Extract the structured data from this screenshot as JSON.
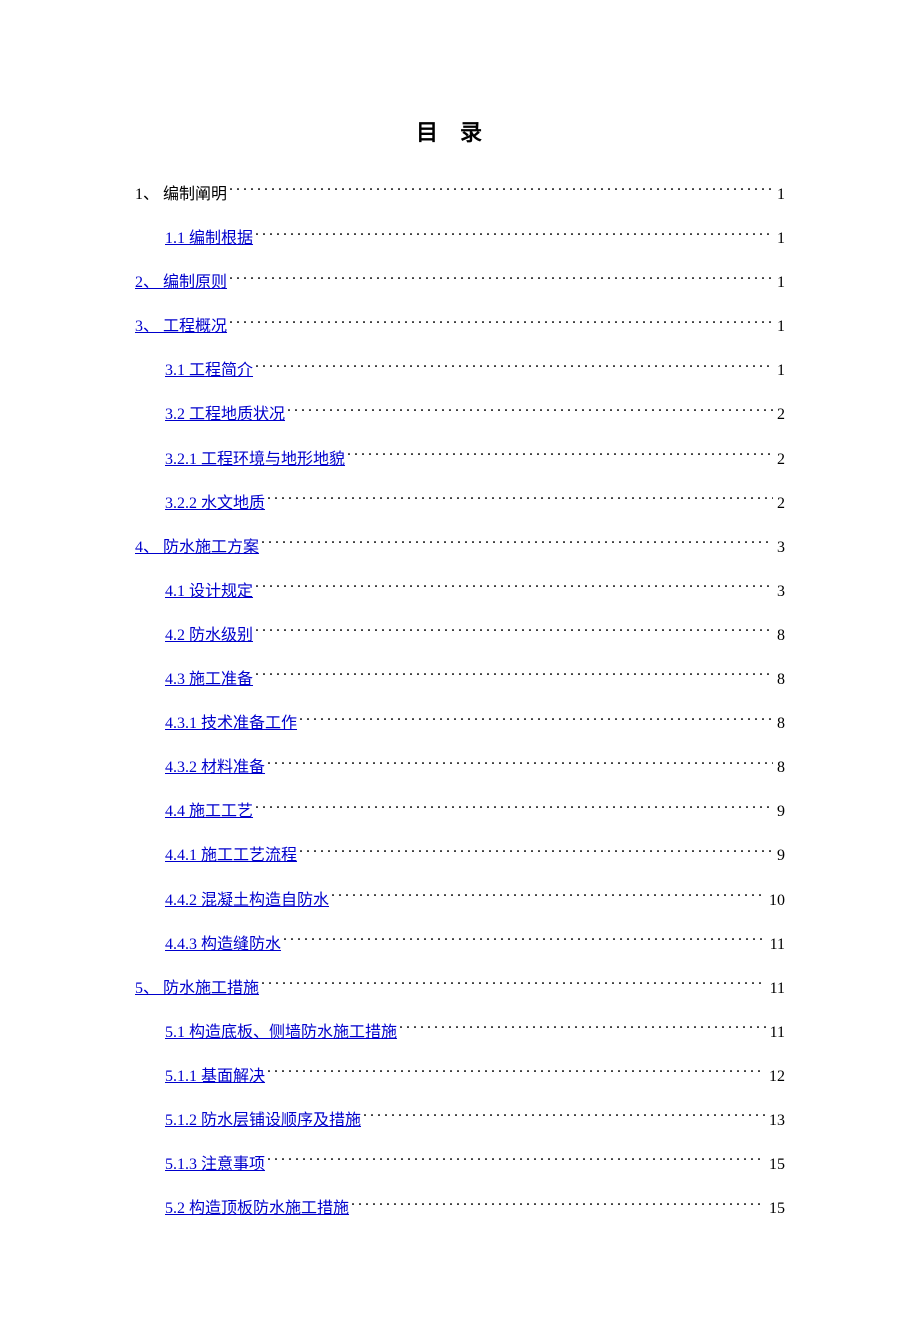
{
  "title": "目录",
  "entries": [
    {
      "indent": 0,
      "label": "1、 编制阐明",
      "page": "1",
      "link": false
    },
    {
      "indent": 1,
      "label": "1.1 编制根据",
      "page": "1",
      "link": true
    },
    {
      "indent": 0,
      "label": "2、 编制原则",
      "page": "1",
      "link": true
    },
    {
      "indent": 0,
      "label": "3、 工程概况",
      "page": "1",
      "link": true
    },
    {
      "indent": 1,
      "label": "3.1 工程简介",
      "page": "1",
      "link": true
    },
    {
      "indent": 1,
      "label": "3.2 工程地质状况",
      "page": "2",
      "link": true
    },
    {
      "indent": 1,
      "label": "3.2.1 工程环境与地形地貌",
      "page": "2",
      "link": true
    },
    {
      "indent": 1,
      "label": "3.2.2 水文地质",
      "page": "2",
      "link": true
    },
    {
      "indent": 0,
      "label": "4、 防水施工方案",
      "page": "3",
      "link": true
    },
    {
      "indent": 1,
      "label": "4.1 设计规定",
      "page": "3",
      "link": true
    },
    {
      "indent": 1,
      "label": "4.2 防水级别",
      "page": "8",
      "link": true
    },
    {
      "indent": 1,
      "label": "4.3 施工准备",
      "page": "8",
      "link": true
    },
    {
      "indent": 1,
      "label": "4.3.1 技术准备工作",
      "page": "8",
      "link": true
    },
    {
      "indent": 1,
      "label": "4.3.2 材料准备",
      "page": "8",
      "link": true
    },
    {
      "indent": 1,
      "label": "4.4 施工工艺",
      "page": "9",
      "link": true
    },
    {
      "indent": 1,
      "label": "4.4.1 施工工艺流程",
      "page": "9",
      "link": true
    },
    {
      "indent": 1,
      "label": "4.4.2 混凝土构造自防水",
      "page": "10",
      "link": true
    },
    {
      "indent": 1,
      "label": "4.4.3 构造缝防水",
      "page": "11",
      "link": true
    },
    {
      "indent": 0,
      "label": "5、 防水施工措施",
      "page": "11",
      "link": true
    },
    {
      "indent": 1,
      "label": "5.1 构造底板、侧墙防水施工措施",
      "page": "11",
      "link": true
    },
    {
      "indent": 1,
      "label": "5.1.1 基面解决",
      "page": "12",
      "link": true
    },
    {
      "indent": 1,
      "label": "5.1.2 防水层铺设顺序及措施",
      "page": "13",
      "link": true
    },
    {
      "indent": 1,
      "label": "5.1.3 注意事项",
      "page": "15",
      "link": true
    },
    {
      "indent": 1,
      "label": "5.2  构造顶板防水施工措施",
      "page": "15",
      "link": true
    }
  ]
}
